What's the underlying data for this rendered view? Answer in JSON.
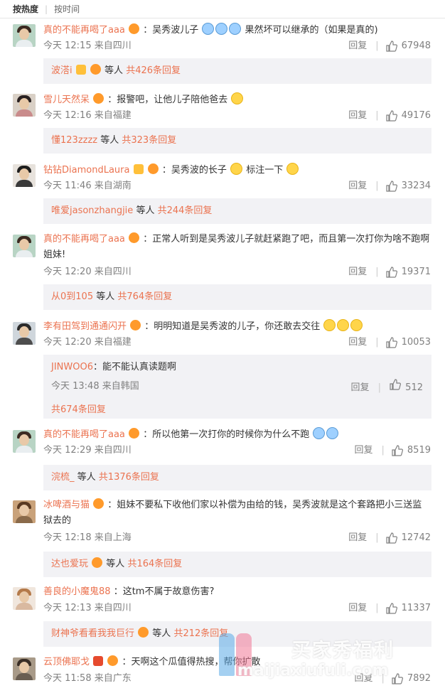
{
  "sort": {
    "hot": "按热度",
    "time": "按时间"
  },
  "labels": {
    "reply": "回复"
  },
  "colors": {
    "username": "#eb7350",
    "meta": "#808080",
    "reply_box": "#f2f2f5"
  },
  "comments": [
    {
      "user": "真的不能再喝了aaa",
      "text": "：吴秀波儿子",
      "text2": "果然坏可以继承的（如果是真的)",
      "time": "今天 12:15 来自四川",
      "likes": "67948",
      "reply_user": "波溚i",
      "reply_text": " 等人 ",
      "reply_count": "共426条回复"
    },
    {
      "user": "雪儿天然呆",
      "text": "：报警吧，让他儿子陪他爸去",
      "time": "今天 12:16 来自福建",
      "likes": "49176",
      "reply_user": "懂123zzzz",
      "reply_text": " 等人 ",
      "reply_count": "共323条回复"
    },
    {
      "user": "钻钻DiamondLaura",
      "text": "：吴秀波的长子",
      "text2": " 标注一下",
      "time": "今天 11:46 来自湖南",
      "likes": "33234",
      "reply_user": "唯爱jasonzhangjie",
      "reply_text": " 等人 ",
      "reply_count": "共244条回复"
    },
    {
      "user": "真的不能再喝了aaa",
      "text": "：正常人听到是吴秀波儿子就赶紧跑了吧，而且第一次打你为啥不跑啊姐妹!",
      "time": "今天 12:20 来自四川",
      "likes": "19371",
      "reply_user": "从0到105",
      "reply_text": " 等人 ",
      "reply_count": "共764条回复"
    },
    {
      "user": "李有田驾到通通闪开",
      "text": "：明明知道是吴秀波的儿子，你还敢去交往",
      "time": "今天 12:20 来自福建",
      "likes": "10053",
      "sub_user": "JINWOO6",
      "sub_text": "：能不能认真读题啊",
      "sub_time": "今天 13:48 来自韩国",
      "sub_likes": "512",
      "reply_count": "共674条回复"
    },
    {
      "user": "真的不能再喝了aaa",
      "text": "：所以他第一次打你的时候你为什么不跑",
      "time": "今天 12:29 来自四川",
      "likes": "8519",
      "reply_user": "浣梳_",
      "reply_text": " 等人 ",
      "reply_count": "共1376条回复"
    },
    {
      "user": "冰啤酒与猫",
      "text": "：姐妹不要私下收他们家以补偿为由给的钱，吴秀波就是这个套路把小三送监狱去的",
      "time": "今天 12:18 来自上海",
      "likes": "12742",
      "reply_user": "达也爱玩",
      "reply_text": " 等人 ",
      "reply_count": "共164条回复"
    },
    {
      "user": "善良的小魔鬼88",
      "text": "：这tm不属于故意伤害?",
      "time": "今天 12:13 来自四川",
      "likes": "11337",
      "reply_user": "财神爷看看我我巨行",
      "reply_text": " 等人 ",
      "reply_count": "共212条回复"
    },
    {
      "user": "云顶佛耶戈",
      "text": "：天啊这个瓜值得热搜，帮你扩散",
      "time": "今天 11:58 来自广东",
      "likes": "7892"
    }
  ],
  "watermark": {
    "cn": "买家秀福利",
    "en": "maijiaxiufuli.com"
  }
}
